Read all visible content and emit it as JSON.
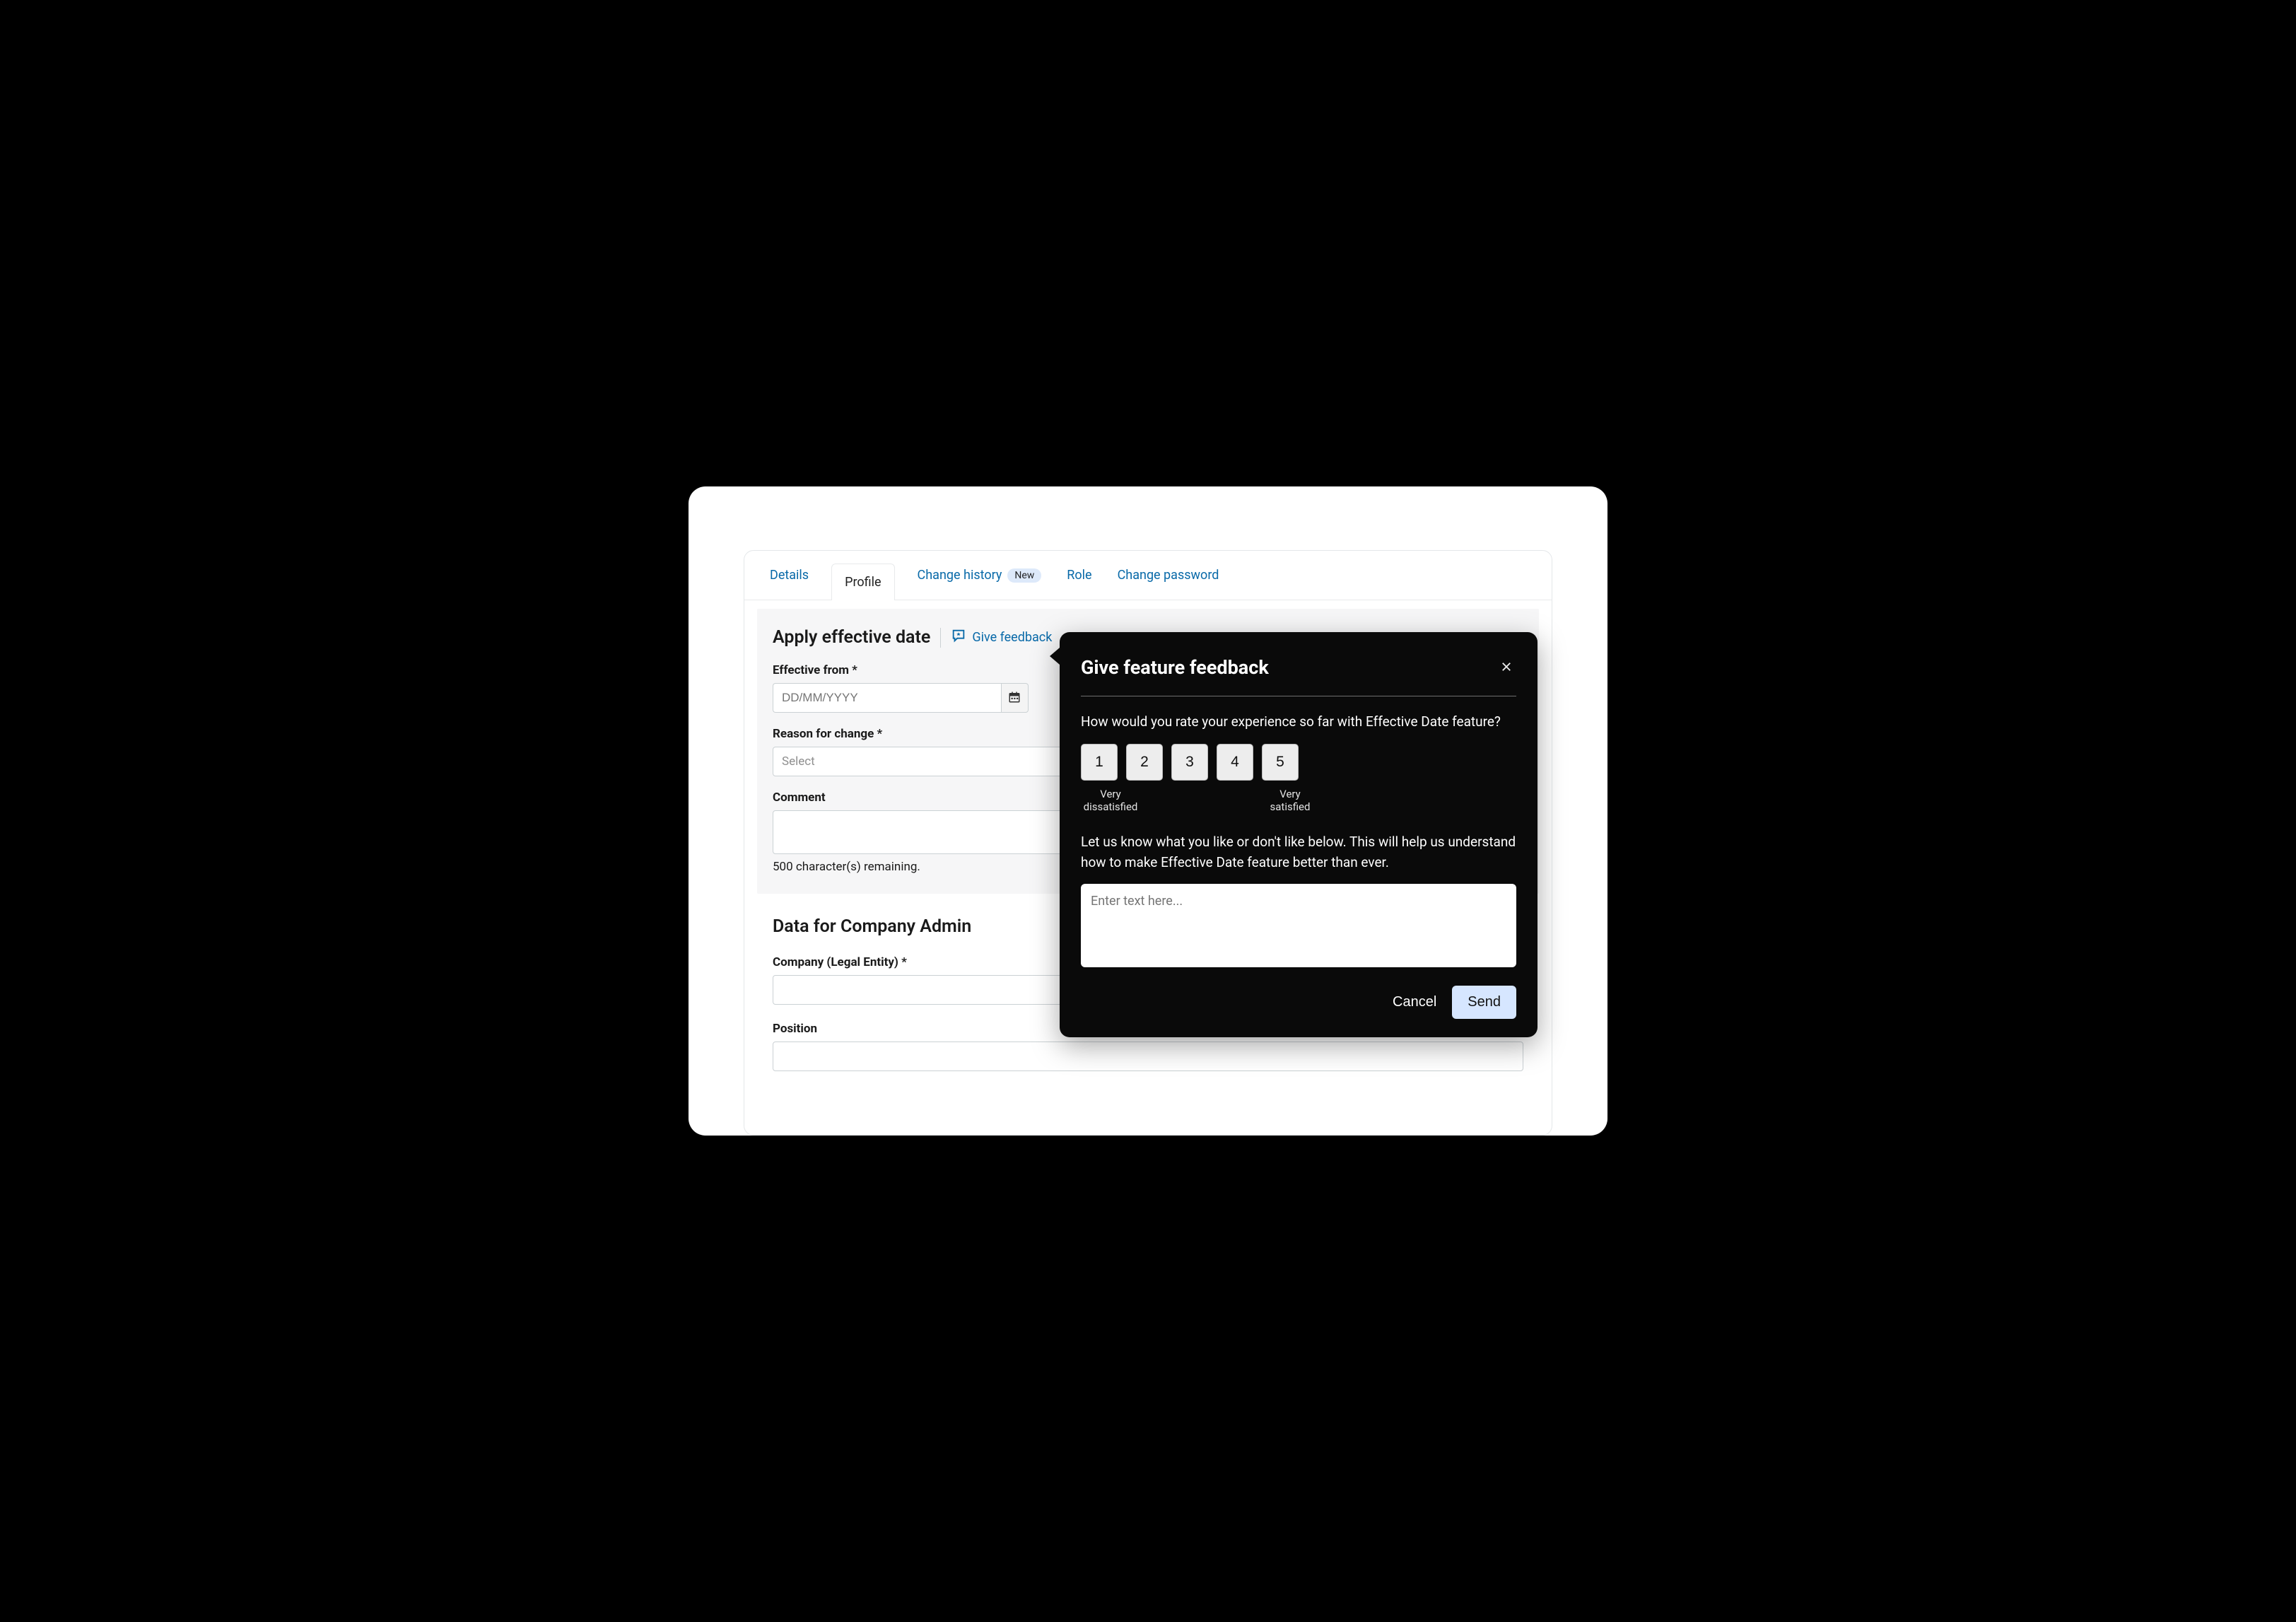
{
  "tabs": {
    "details": "Details",
    "profile": "Profile",
    "change_history": "Change history",
    "new_pill": "New",
    "role": "Role",
    "change_password": "Change password"
  },
  "effective": {
    "title": "Apply effective date",
    "give_feedback": "Give feedback",
    "from_label": "Effective from *",
    "from_placeholder": "DD/MM/YYYY",
    "reason_label": "Reason for change *",
    "reason_placeholder": "Select",
    "comment_label": "Comment",
    "char_remaining": "500 character(s) remaining."
  },
  "company": {
    "title": "Data for Company Admin",
    "entity_label": "Company (Legal Entity) *",
    "position_label": "Position"
  },
  "popover": {
    "title": "Give feature feedback",
    "question": "How would you rate your experience so far with Effective Date feature?",
    "ratings": [
      "1",
      "2",
      "3",
      "4",
      "5"
    ],
    "lbl_low": "Very dissatisfied",
    "lbl_high": "Very satisfied",
    "instruction": "Let us know what you like or don't like below. This will help us understand how to make Effective Date feature better than ever.",
    "placeholder": "Enter text here...",
    "cancel": "Cancel",
    "send": "Send"
  }
}
